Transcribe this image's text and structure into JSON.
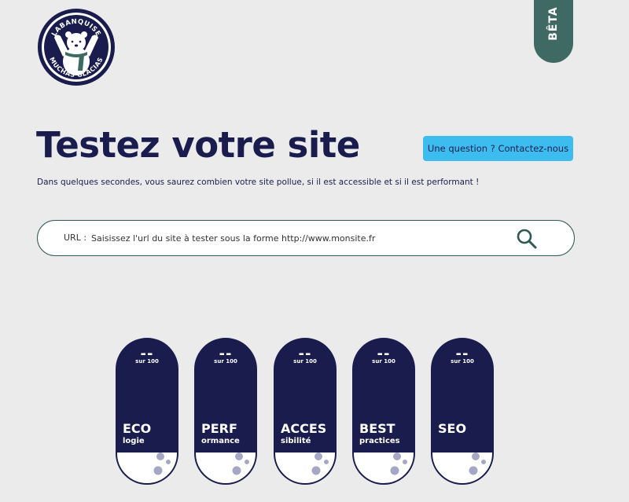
{
  "brand": {
    "logo_text_top": "LABANQUISE",
    "logo_text_bottom": "MUCHAS GLACIAS",
    "navy": "#1a1c4e",
    "green": "#3f6a63",
    "accent": "#3cbcef"
  },
  "beta_label": "BÊTA",
  "hero": {
    "title": "Testez votre site",
    "subtitle": "Dans quelques secondes, vous saurez combien votre site pollue, si il est accessible et si il est performant !",
    "contact_label": "Une question ? Contactez-nous"
  },
  "search": {
    "label": "URL :",
    "placeholder": "Saisissez l'url du site à tester sous la forme http://www.monsite.fr",
    "icon": "search-icon"
  },
  "gauges": [
    {
      "score": "--",
      "max": "sur 100",
      "title": "ECO",
      "sub": "logie"
    },
    {
      "score": "--",
      "max": "sur 100",
      "title": "PERF",
      "sub": "ormance"
    },
    {
      "score": "--",
      "max": "sur 100",
      "title": "ACCES",
      "sub": "sibilité"
    },
    {
      "score": "--",
      "max": "sur 100",
      "title": "BEST",
      "sub": "practices"
    },
    {
      "score": "--",
      "max": "sur 100",
      "title": "SEO",
      "sub": ""
    }
  ]
}
